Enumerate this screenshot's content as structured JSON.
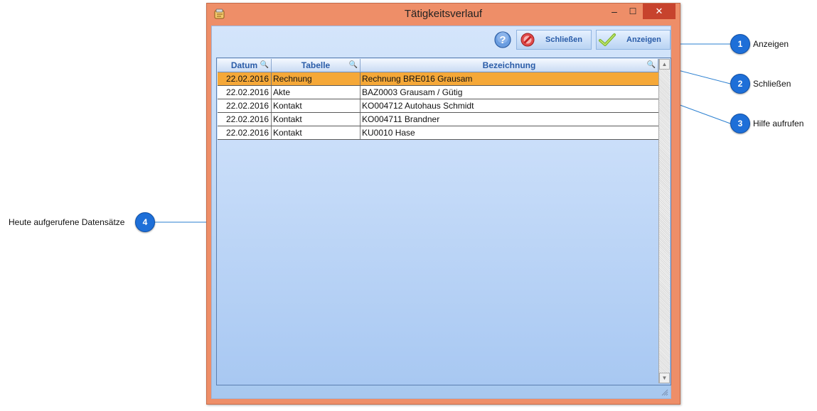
{
  "window": {
    "title": "Tätigkeitsverlauf",
    "minimize_glyph": "‒",
    "maximize_glyph": "☐",
    "close_glyph": "✕"
  },
  "toolbar": {
    "help_icon": "question-icon",
    "close_label": "Schließen",
    "show_label": "Anzeigen"
  },
  "grid": {
    "columns": [
      "Datum",
      "Tabelle",
      "Bezeichnung"
    ],
    "rows": [
      {
        "datum": "22.02.2016",
        "tabelle": "Rechnung",
        "bezeichnung": "Rechnung BRE016 Grausam",
        "selected": true
      },
      {
        "datum": "22.02.2016",
        "tabelle": "Akte",
        "bezeichnung": "BAZ0003 Grausam / Gütig"
      },
      {
        "datum": "22.02.2016",
        "tabelle": "Kontakt",
        "bezeichnung": "KO004712 Autohaus Schmidt"
      },
      {
        "datum": "22.02.2016",
        "tabelle": "Kontakt",
        "bezeichnung": "KO004711 Brandner"
      },
      {
        "datum": "22.02.2016",
        "tabelle": "Kontakt",
        "bezeichnung": "KU0010 Hase"
      }
    ]
  },
  "callouts": [
    {
      "number": "1",
      "label": "Anzeigen"
    },
    {
      "number": "2",
      "label": "Schließen"
    },
    {
      "number": "3",
      "label": "Hilfe aufrufen"
    },
    {
      "number": "4",
      "label": "Heute aufgerufene Datensätze"
    }
  ],
  "colors": {
    "window_frame": "#ee8e68",
    "close_button": "#c7432d",
    "selection": "#f5a838",
    "callout": "#1e6fd8",
    "leader_line": "#2a7fd0"
  }
}
